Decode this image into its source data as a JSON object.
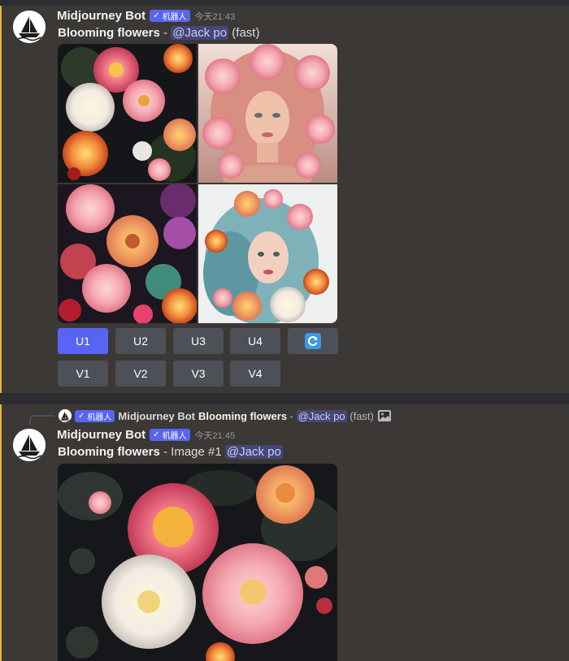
{
  "colors": {
    "accent": "#5865f2",
    "background": "#3b3835",
    "highlight_bar": "#f0b232",
    "button_grey": "#4e5058"
  },
  "message1": {
    "username": "Midjourney Bot",
    "badge": "机器人",
    "timestamp": "今天21:43",
    "prompt": "Blooming flowers",
    "separator": " - ",
    "mention": "@Jack po",
    "mode": "(fast)",
    "upscale_buttons": [
      "U1",
      "U2",
      "U3",
      "U4"
    ],
    "variation_buttons": [
      "V1",
      "V2",
      "V3",
      "V4"
    ],
    "reroll_icon": "refresh-icon"
  },
  "message2": {
    "reply": {
      "badge": "机器人",
      "username": "Midjourney Bot",
      "prompt": "Blooming flowers",
      "separator": " - ",
      "mention": "@Jack po",
      "mode": "(fast)",
      "image_icon": "image-icon"
    },
    "username": "Midjourney Bot",
    "badge": "机器人",
    "timestamp": "今天21:45",
    "prompt": "Blooming flowers",
    "image_label": " - Image #1 ",
    "mention": "@Jack po"
  }
}
